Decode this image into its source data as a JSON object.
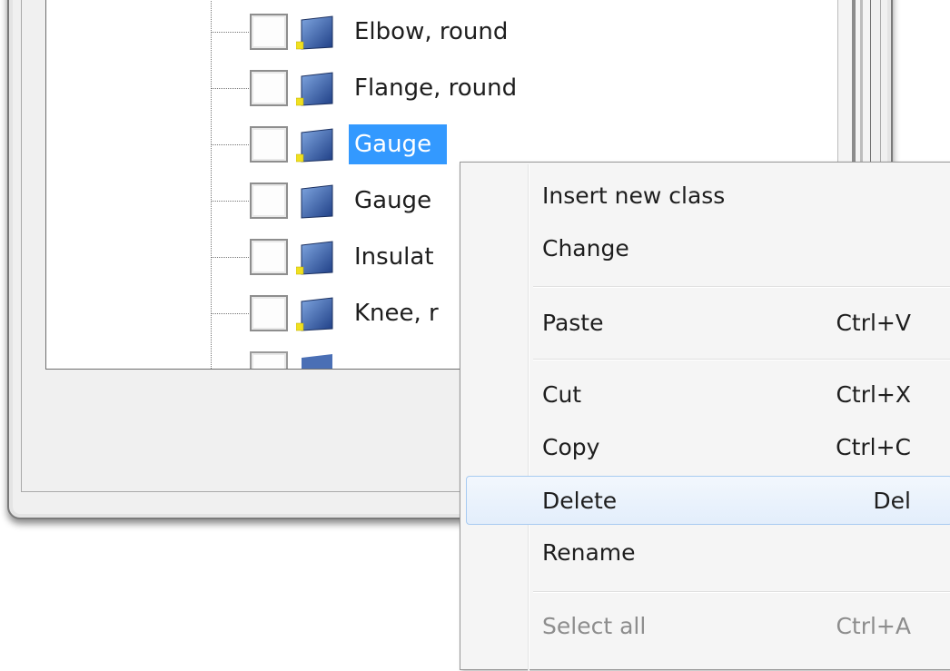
{
  "tree": {
    "items": [
      {
        "label": "Elbow, round",
        "icon": "class-icon",
        "checked": false,
        "selected": false
      },
      {
        "label": "Flange, round",
        "icon": "class-icon",
        "checked": false,
        "selected": false
      },
      {
        "label": "Gauge",
        "icon": "class-icon",
        "checked": false,
        "selected": true
      },
      {
        "label": "Gauge",
        "icon": "class-icon",
        "checked": false,
        "selected": false
      },
      {
        "label": "Insulat",
        "icon": "class-icon",
        "checked": false,
        "selected": false
      },
      {
        "label": "Knee, r",
        "icon": "class-icon",
        "checked": false,
        "selected": false
      }
    ]
  },
  "context_menu": {
    "items": [
      {
        "label": "Insert new class",
        "shortcut": "",
        "enabled": true
      },
      {
        "label": "Change",
        "shortcut": "",
        "enabled": true
      },
      {
        "label": "Paste",
        "shortcut": "Ctrl+V",
        "enabled": true
      },
      {
        "label": "Cut",
        "shortcut": "Ctrl+X",
        "enabled": true
      },
      {
        "label": "Copy",
        "shortcut": "Ctrl+C",
        "enabled": true
      },
      {
        "label": "Delete",
        "shortcut": "Del",
        "enabled": true,
        "highlighted": true
      },
      {
        "label": "Rename",
        "shortcut": "",
        "enabled": true
      },
      {
        "label": "Select all",
        "shortcut": "Ctrl+A",
        "enabled": false
      }
    ]
  },
  "colors": {
    "selection": "#3399ff",
    "menu_highlight_border": "#a8cbf1",
    "class_icon": "#3a5fa8",
    "overlay_marker": "#f0e020"
  }
}
